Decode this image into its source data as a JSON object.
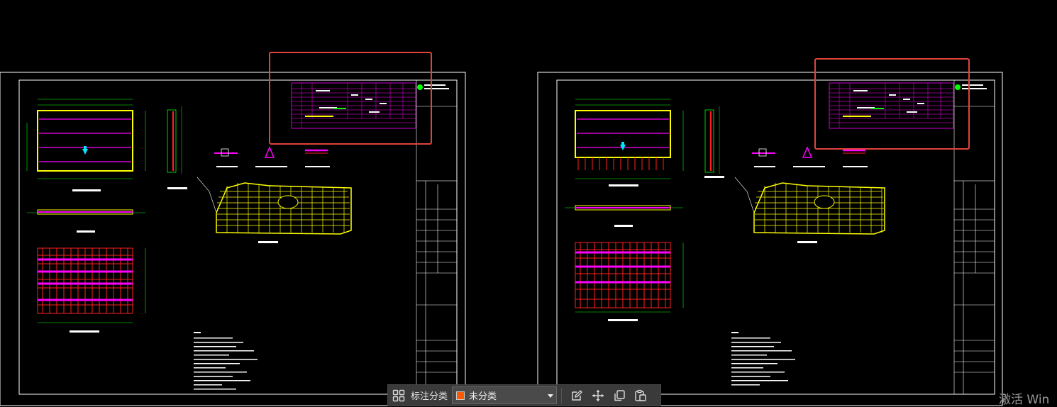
{
  "toolbar": {
    "annotation_label": "标注分类",
    "category_value": "未分类",
    "category_color": "#ff5a00"
  },
  "watermark": "激活 Win",
  "colors": {
    "background": "#000000",
    "frame": "#ffffff",
    "highlight": "#e0433a",
    "magenta": "#ff00ff",
    "yellow": "#ffff00",
    "green": "#00ff00",
    "red": "#ff2020",
    "cyan": "#00e5ff"
  },
  "icons": [
    "grid-icon",
    "edit-icon",
    "move-icon",
    "copy-icon",
    "paste-icon",
    "chevron-down-icon"
  ]
}
